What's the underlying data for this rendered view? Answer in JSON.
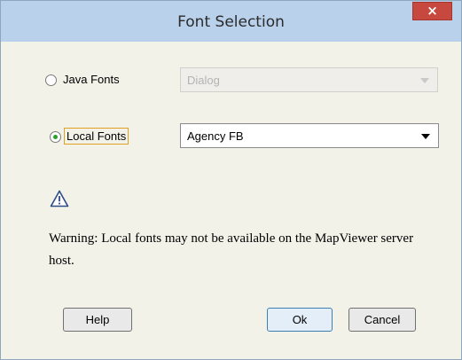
{
  "window": {
    "title": "Font Selection",
    "close_glyph": "×"
  },
  "java_fonts": {
    "label": "Java Fonts",
    "selected": false,
    "combo_value": "Dialog",
    "combo_enabled": false
  },
  "local_fonts": {
    "label": "Local Fonts",
    "selected": true,
    "combo_value": "Agency FB",
    "combo_enabled": true
  },
  "warning": {
    "icon": "warning-triangle-icon",
    "text": "Warning: Local fonts may not be available on the MapViewer server host."
  },
  "buttons": {
    "help": "Help",
    "ok": "Ok",
    "cancel": "Cancel"
  },
  "colors": {
    "titlebar": "#b9d1ea",
    "close_button": "#c7483e",
    "dialog_bg": "#f3f2e9",
    "radio_selected": "#2aa12a",
    "focus_outline": "#e0a020"
  }
}
